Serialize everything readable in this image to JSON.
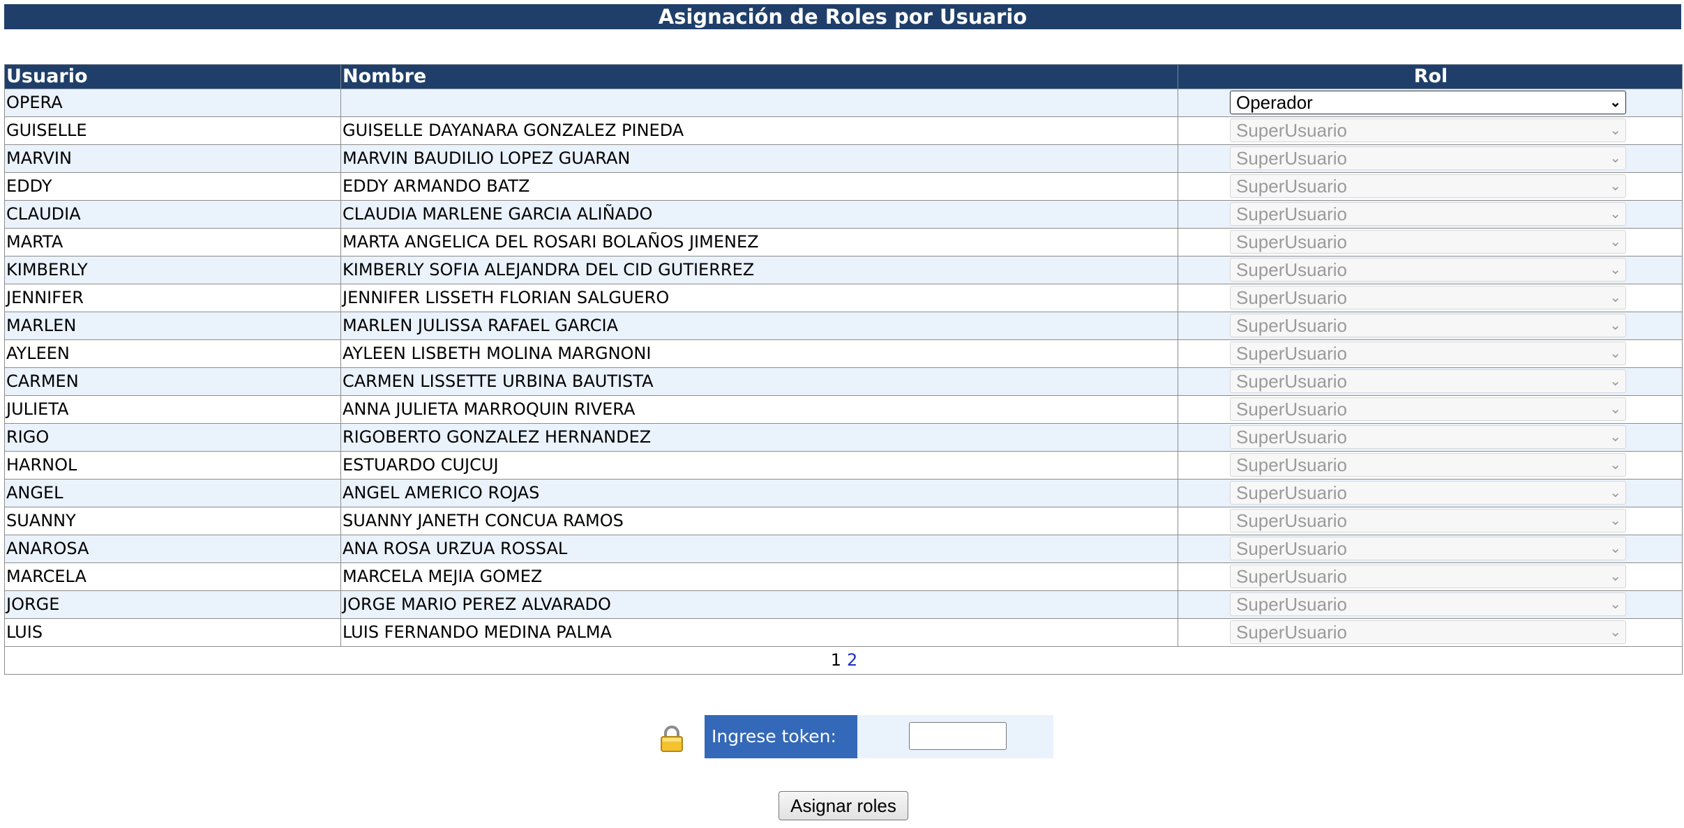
{
  "page": {
    "title": "Asignación de Roles por Usuario"
  },
  "table": {
    "headers": {
      "usuario": "Usuario",
      "nombre": "Nombre",
      "rol": "Rol"
    },
    "rows": [
      {
        "usuario": "OPERA",
        "nombre": "",
        "rol": "Operador",
        "enabled": true
      },
      {
        "usuario": "GUISELLE",
        "nombre": "GUISELLE DAYANARA GONZALEZ PINEDA",
        "rol": "SuperUsuario",
        "enabled": false
      },
      {
        "usuario": "MARVIN",
        "nombre": "MARVIN BAUDILIO LOPEZ GUARAN",
        "rol": "SuperUsuario",
        "enabled": false
      },
      {
        "usuario": "EDDY",
        "nombre": "EDDY ARMANDO BATZ",
        "rol": "SuperUsuario",
        "enabled": false
      },
      {
        "usuario": "CLAUDIA",
        "nombre": "CLAUDIA MARLENE GARCIA ALIÑADO",
        "rol": "SuperUsuario",
        "enabled": false
      },
      {
        "usuario": "MARTA",
        "nombre": "MARTA ANGELICA DEL ROSARI BOLAÑOS JIMENEZ",
        "rol": "SuperUsuario",
        "enabled": false
      },
      {
        "usuario": "KIMBERLY",
        "nombre": "KIMBERLY SOFIA ALEJANDRA DEL CID GUTIERREZ",
        "rol": "SuperUsuario",
        "enabled": false
      },
      {
        "usuario": "JENNIFER",
        "nombre": "JENNIFER LISSETH FLORIAN SALGUERO",
        "rol": "SuperUsuario",
        "enabled": false
      },
      {
        "usuario": "MARLEN",
        "nombre": "MARLEN JULISSA RAFAEL GARCIA",
        "rol": "SuperUsuario",
        "enabled": false
      },
      {
        "usuario": "AYLEEN",
        "nombre": "AYLEEN LISBETH MOLINA MARGNONI",
        "rol": "SuperUsuario",
        "enabled": false
      },
      {
        "usuario": "CARMEN",
        "nombre": "CARMEN LISSETTE URBINA BAUTISTA",
        "rol": "SuperUsuario",
        "enabled": false
      },
      {
        "usuario": "JULIETA",
        "nombre": "ANNA JULIETA MARROQUIN RIVERA",
        "rol": "SuperUsuario",
        "enabled": false
      },
      {
        "usuario": "RIGO",
        "nombre": "RIGOBERTO GONZALEZ HERNANDEZ",
        "rol": "SuperUsuario",
        "enabled": false
      },
      {
        "usuario": "HARNOL",
        "nombre": "ESTUARDO CUJCUJ",
        "rol": "SuperUsuario",
        "enabled": false
      },
      {
        "usuario": "ANGEL",
        "nombre": "ANGEL AMERICO ROJAS",
        "rol": "SuperUsuario",
        "enabled": false
      },
      {
        "usuario": "SUANNY",
        "nombre": "SUANNY JANETH CONCUA RAMOS",
        "rol": "SuperUsuario",
        "enabled": false
      },
      {
        "usuario": "ANAROSA",
        "nombre": "ANA ROSA URZUA ROSSAL",
        "rol": "SuperUsuario",
        "enabled": false
      },
      {
        "usuario": "MARCELA",
        "nombre": "MARCELA MEJIA GOMEZ",
        "rol": "SuperUsuario",
        "enabled": false
      },
      {
        "usuario": "JORGE",
        "nombre": "JORGE MARIO PEREZ ALVARADO",
        "rol": "SuperUsuario",
        "enabled": false
      },
      {
        "usuario": "LUIS",
        "nombre": "LUIS FERNANDO MEDINA PALMA",
        "rol": "SuperUsuario",
        "enabled": false
      }
    ]
  },
  "pagination": {
    "current_page": "1",
    "other_page": "2"
  },
  "token": {
    "icon": "lock-icon",
    "label": "Ingrese token:",
    "value": ""
  },
  "actions": {
    "assign_label": "Asignar roles"
  },
  "colors": {
    "header_bg": "#1f3f6a",
    "row_alt_bg": "#eaf2fc",
    "token_label_bg": "#3468b8",
    "link": "#1c2fc4"
  }
}
